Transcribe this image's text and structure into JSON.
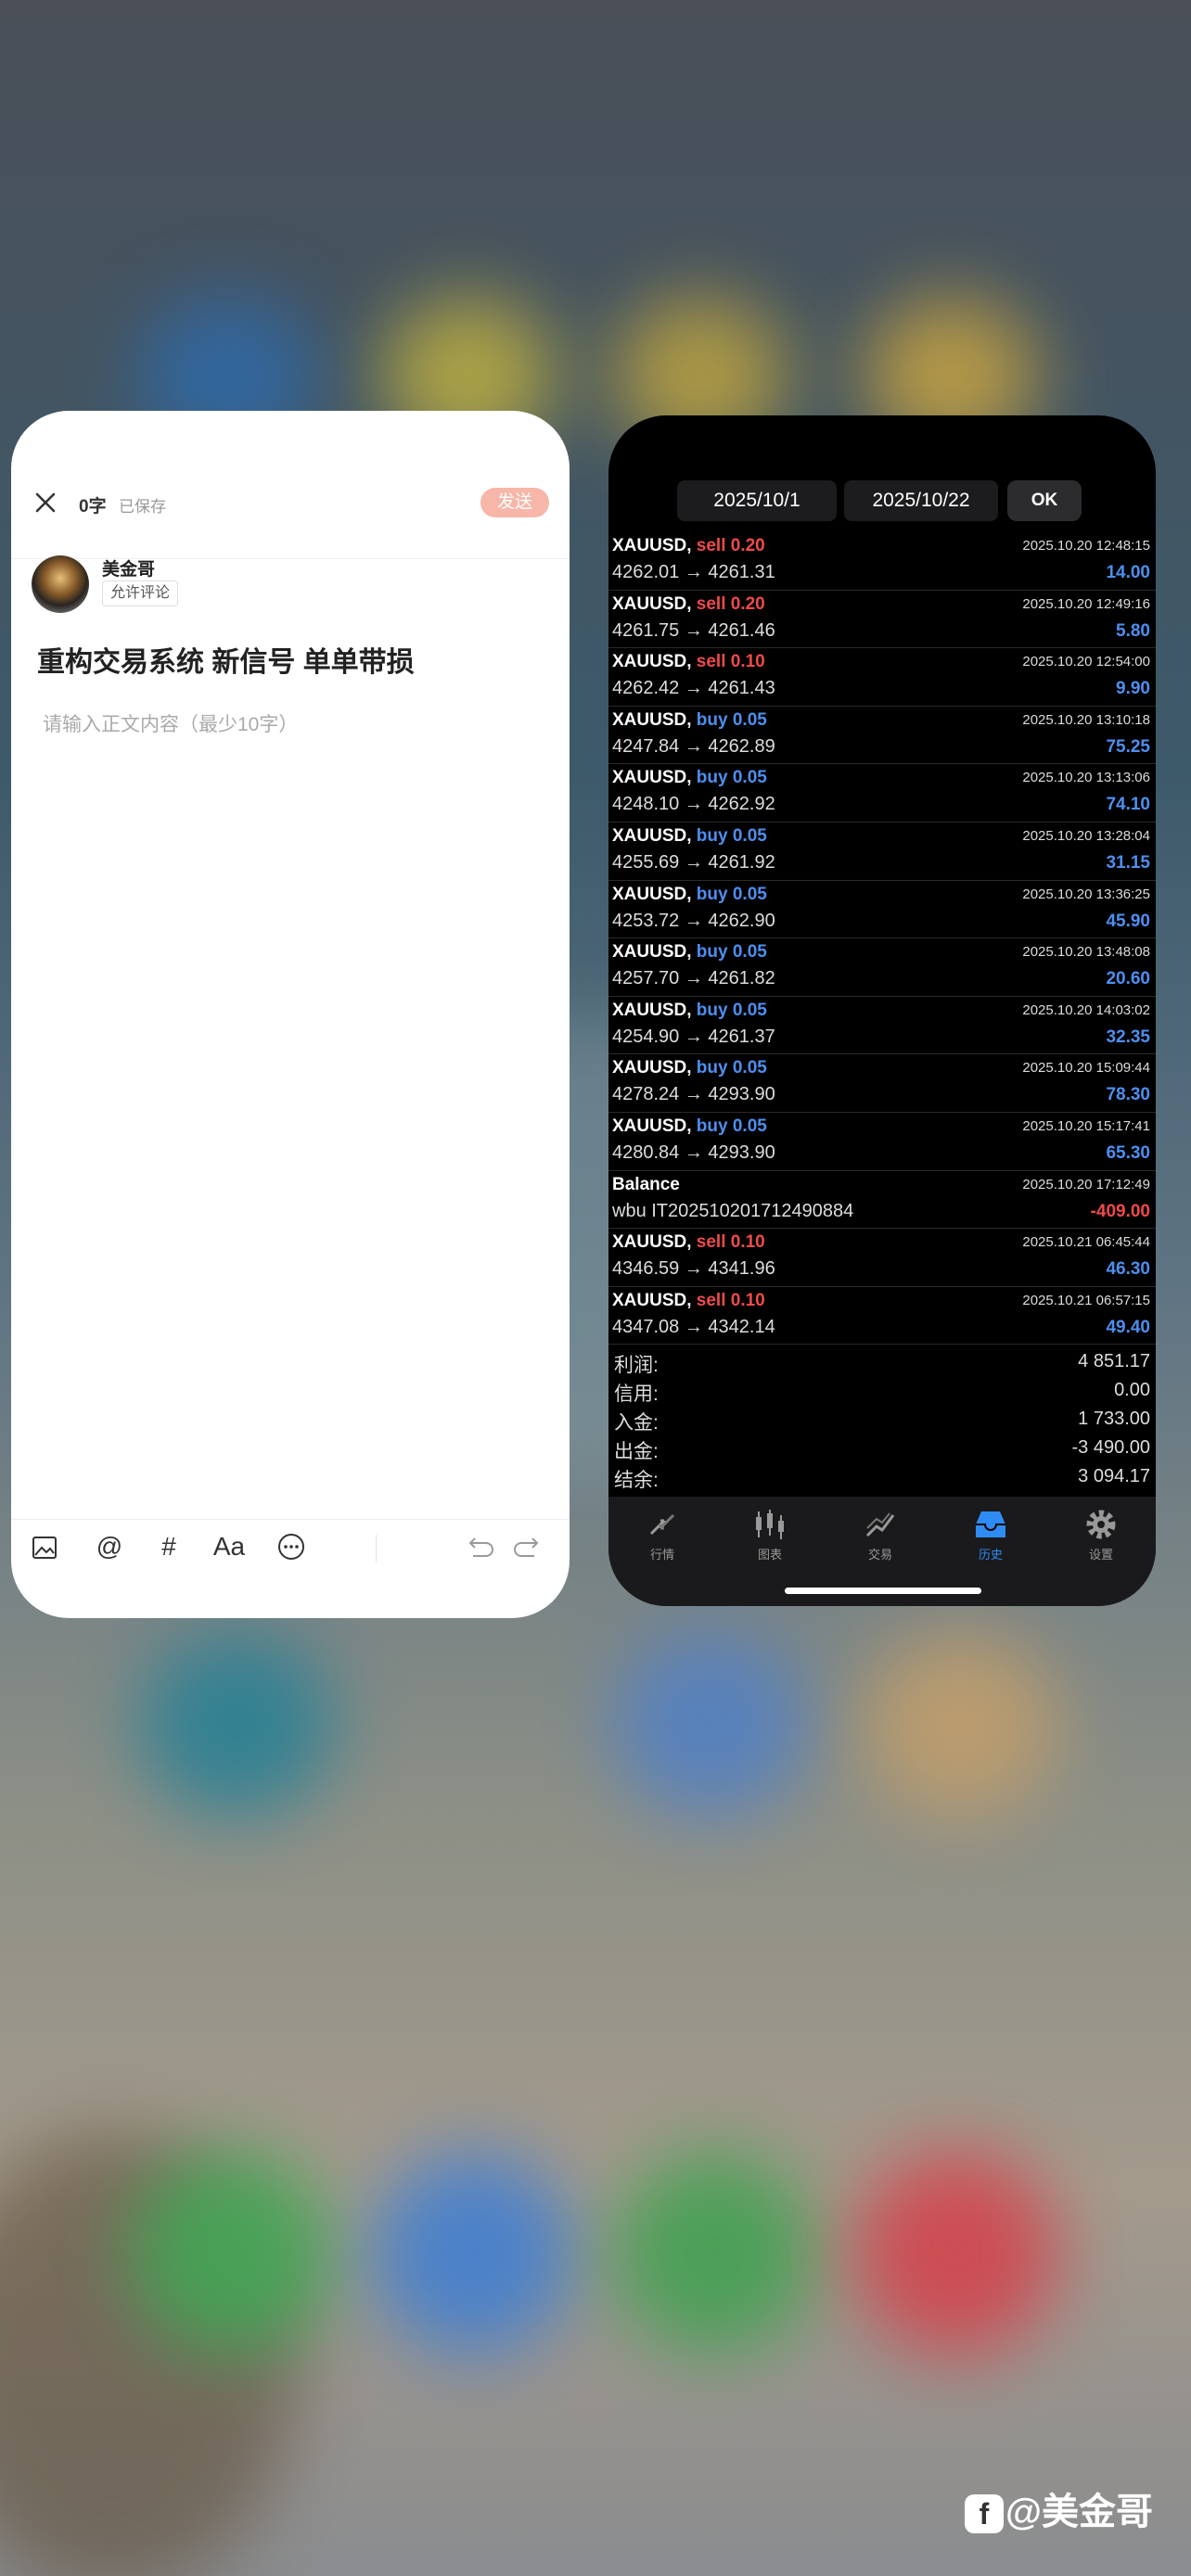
{
  "editor": {
    "word_count": "0字",
    "save_status": "已保存",
    "send_label": "发送",
    "author_name": "美金哥",
    "comment_tag": "允许评论",
    "post_title": "重构交易系统 新信号 单单带损",
    "body_placeholder": "请输入正文内容（最少10字）",
    "toolbar_text_label": "Aa"
  },
  "trading": {
    "date_from": "2025/10/1",
    "date_to": "2025/10/22",
    "ok_label": "OK",
    "colors": {
      "sell": "#f04a4a",
      "buy": "#4d8ff0",
      "active_tab": "#2f8cf5"
    },
    "deals": [
      {
        "symbol": "XAUUSD,",
        "side": "sell",
        "volume": "sell 0.20",
        "time": "2025.10.20 12:48:15",
        "prices": "4262.01 → 4261.31",
        "profit": "14.00"
      },
      {
        "symbol": "XAUUSD,",
        "side": "sell",
        "volume": "sell 0.20",
        "time": "2025.10.20 12:49:16",
        "prices": "4261.75 → 4261.46",
        "profit": "5.80"
      },
      {
        "symbol": "XAUUSD,",
        "side": "sell",
        "volume": "sell 0.10",
        "time": "2025.10.20 12:54:00",
        "prices": "4262.42 → 4261.43",
        "profit": "9.90"
      },
      {
        "symbol": "XAUUSD,",
        "side": "buy",
        "volume": "buy 0.05",
        "time": "2025.10.20 13:10:18",
        "prices": "4247.84 → 4262.89",
        "profit": "75.25"
      },
      {
        "symbol": "XAUUSD,",
        "side": "buy",
        "volume": "buy 0.05",
        "time": "2025.10.20 13:13:06",
        "prices": "4248.10 → 4262.92",
        "profit": "74.10"
      },
      {
        "symbol": "XAUUSD,",
        "side": "buy",
        "volume": "buy 0.05",
        "time": "2025.10.20 13:28:04",
        "prices": "4255.69 → 4261.92",
        "profit": "31.15"
      },
      {
        "symbol": "XAUUSD,",
        "side": "buy",
        "volume": "buy 0.05",
        "time": "2025.10.20 13:36:25",
        "prices": "4253.72 → 4262.90",
        "profit": "45.90"
      },
      {
        "symbol": "XAUUSD,",
        "side": "buy",
        "volume": "buy 0.05",
        "time": "2025.10.20 13:48:08",
        "prices": "4257.70 → 4261.82",
        "profit": "20.60"
      },
      {
        "symbol": "XAUUSD,",
        "side": "buy",
        "volume": "buy 0.05",
        "time": "2025.10.20 14:03:02",
        "prices": "4254.90 → 4261.37",
        "profit": "32.35"
      },
      {
        "symbol": "XAUUSD,",
        "side": "buy",
        "volume": "buy 0.05",
        "time": "2025.10.20 15:09:44",
        "prices": "4278.24 → 4293.90",
        "profit": "78.30"
      },
      {
        "symbol": "XAUUSD,",
        "side": "buy",
        "volume": "buy 0.05",
        "time": "2025.10.20 15:17:41",
        "prices": "4280.84 → 4293.90",
        "profit": "65.30"
      },
      {
        "symbol": "Balance",
        "side": "balance",
        "volume": "",
        "time": "2025.10.20 17:12:49",
        "prices": "wbu IT202510201712490884",
        "profit": "-409.00"
      },
      {
        "symbol": "XAUUSD,",
        "side": "sell",
        "volume": "sell 0.10",
        "time": "2025.10.21 06:45:44",
        "prices": "4346.59 → 4341.96",
        "profit": "46.30"
      },
      {
        "symbol": "XAUUSD,",
        "side": "sell",
        "volume": "sell 0.10",
        "time": "2025.10.21 06:57:15",
        "prices": "4347.08 → 4342.14",
        "profit": "49.40"
      }
    ],
    "summary": [
      {
        "label": "利润:",
        "value": "4 851.17"
      },
      {
        "label": "信用:",
        "value": "0.00"
      },
      {
        "label": "入金:",
        "value": "1 733.00"
      },
      {
        "label": "出金:",
        "value": "-3 490.00"
      },
      {
        "label": "结余:",
        "value": "3 094.17"
      }
    ],
    "tabs": [
      {
        "label": "行情",
        "icon": "quotes-icon",
        "active": false
      },
      {
        "label": "图表",
        "icon": "chart-icon",
        "active": false
      },
      {
        "label": "交易",
        "icon": "trade-icon",
        "active": false
      },
      {
        "label": "历史",
        "icon": "history-icon",
        "active": true
      },
      {
        "label": "设置",
        "icon": "settings-icon",
        "active": false
      }
    ]
  },
  "watermark": {
    "logo": "f",
    "text": "@美金哥"
  }
}
